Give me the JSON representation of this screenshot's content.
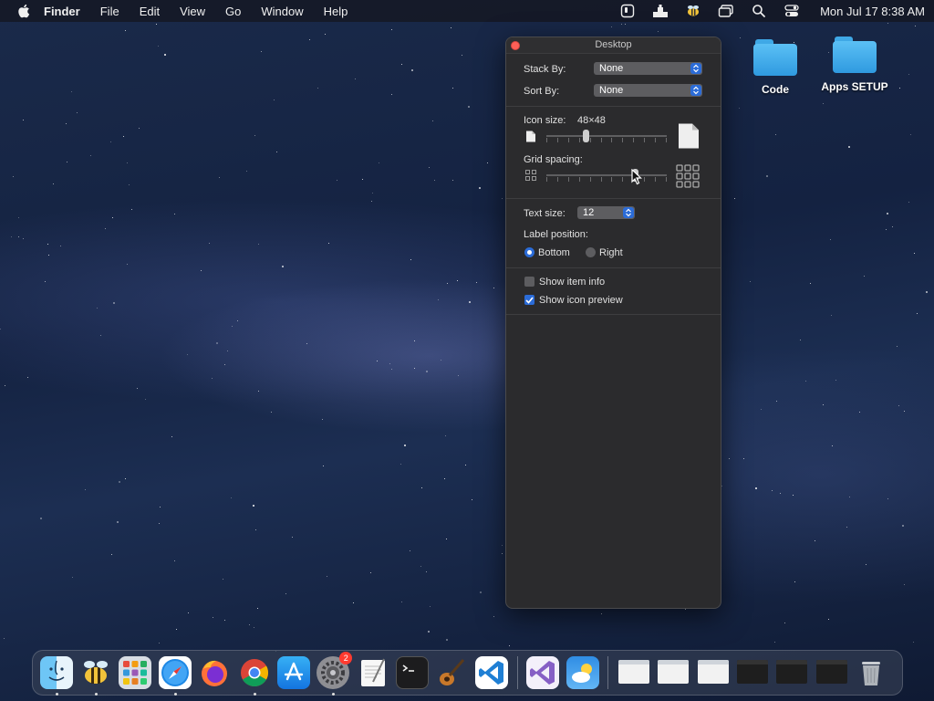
{
  "menubar": {
    "app_name": "Finder",
    "menus": [
      "File",
      "Edit",
      "View",
      "Go",
      "Window",
      "Help"
    ],
    "status_icons": [
      "screen-record-icon",
      "upload-tray-icon",
      "bee-app-icon",
      "screen-mirroring-icon",
      "spotlight-search-icon",
      "control-center-icon"
    ],
    "clock": "Mon Jul 17  8:38 AM"
  },
  "desktop": {
    "folders": [
      {
        "label": "Code"
      },
      {
        "label": "Apps SETUP"
      }
    ]
  },
  "view_options": {
    "title": "Desktop",
    "stack_by_label": "Stack By:",
    "stack_by_value": "None",
    "sort_by_label": "Sort By:",
    "sort_by_value": "None",
    "icon_size_label": "Icon size:",
    "icon_size_value": "48×48",
    "icon_size_level": 0.32,
    "grid_spacing_label": "Grid spacing:",
    "grid_spacing_level": 0.75,
    "text_size_label": "Text size:",
    "text_size_value": "12",
    "label_position_label": "Label position:",
    "label_position_options": [
      "Bottom",
      "Right"
    ],
    "label_position_selected": "Bottom",
    "show_item_info_label": "Show item info",
    "show_item_info_checked": false,
    "show_icon_preview_label": "Show icon preview",
    "show_icon_preview_checked": true
  },
  "dock": {
    "apps": [
      {
        "name": "finder",
        "running": true
      },
      {
        "name": "bee",
        "running": true
      },
      {
        "name": "launchpad",
        "running": false
      },
      {
        "name": "safari",
        "running": true
      },
      {
        "name": "firefox",
        "running": false
      },
      {
        "name": "chrome",
        "running": true
      },
      {
        "name": "app-store",
        "running": false
      },
      {
        "name": "system-preferences",
        "running": true,
        "badge": "2"
      },
      {
        "name": "textedit",
        "running": false
      },
      {
        "name": "terminal",
        "running": false
      },
      {
        "name": "instruments",
        "running": false
      },
      {
        "name": "vscode",
        "running": false
      }
    ],
    "recent_apps": [
      "visual-studio",
      "weather"
    ],
    "minimized_windows": [
      "safari-window",
      "chrome-window",
      "textedit-window",
      "window-4",
      "window-5",
      "window-6"
    ],
    "trash": "trash"
  },
  "colors": {
    "accent": "#2b6cd8",
    "panel_bg": "#2b2b2d",
    "folder_blue": "#3fa8e6",
    "close_red": "#fe5f57"
  }
}
